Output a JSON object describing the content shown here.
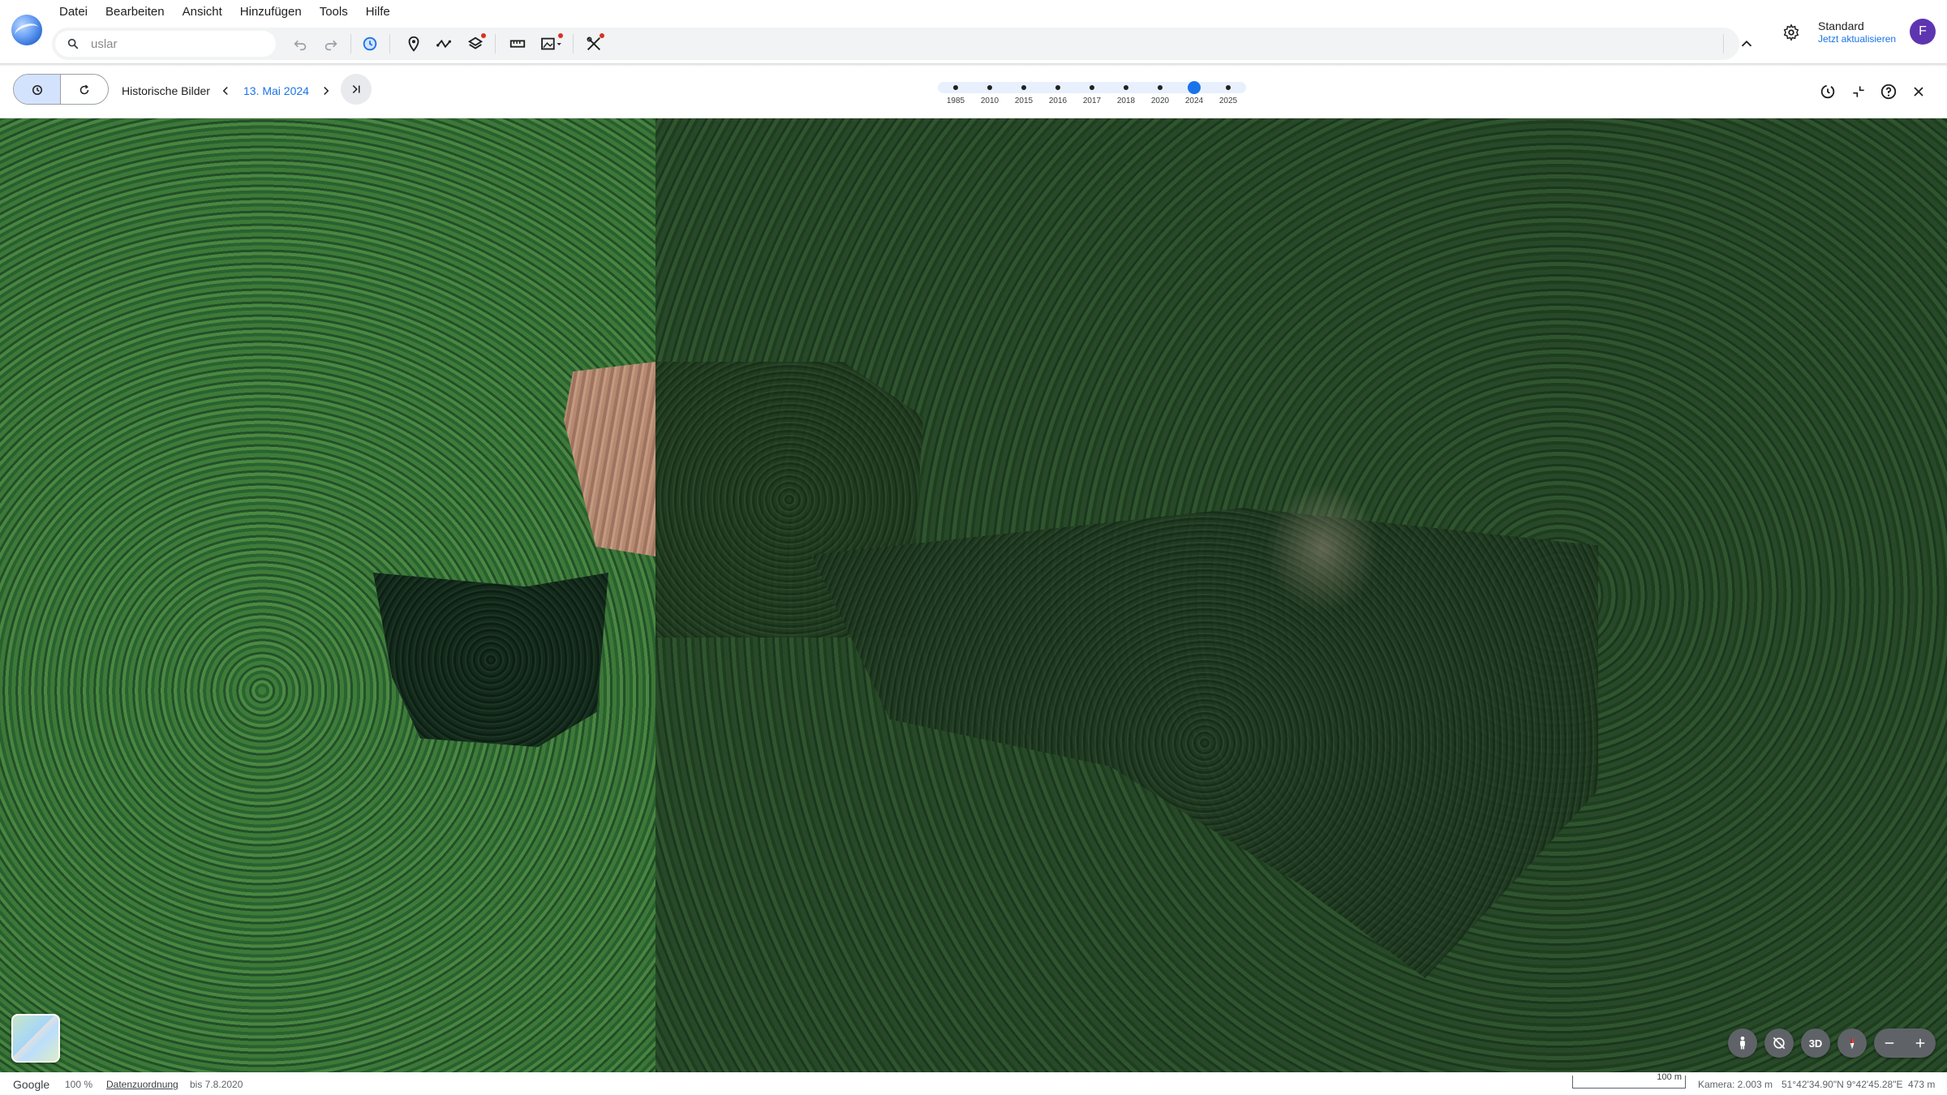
{
  "menu": {
    "items": [
      {
        "label": "Datei"
      },
      {
        "label": "Bearbeiten"
      },
      {
        "label": "Ansicht"
      },
      {
        "label": "Hinzufügen"
      },
      {
        "label": "Tools"
      },
      {
        "label": "Hilfe"
      }
    ]
  },
  "search": {
    "value": "",
    "placeholder": "uslar"
  },
  "account": {
    "plan": "Standard",
    "update": "Jetzt aktualisieren",
    "avatar_letter": "F",
    "avatar_color": "#5e35b1"
  },
  "historical": {
    "label": "Historische Bilder",
    "current_date": "13. Mai 2024",
    "years": [
      "1985",
      "2010",
      "2015",
      "2016",
      "2017",
      "2018",
      "2020",
      "2024",
      "2025"
    ],
    "selected_year": "2024"
  },
  "map_controls": {
    "three_d": "3D"
  },
  "status": {
    "brand": "Google",
    "zoom": "100 %",
    "attribution": "Datenzuordnung",
    "imagery_date": "bis 7.8.2020",
    "scale": "100 m",
    "camera": "Kamera: 2.003 m",
    "coords": "51°42'34.90\"N 9°42'45.28\"E",
    "elevation": "473 m"
  },
  "colors": {
    "accent": "#1a73e8",
    "notification_dot": "#d93025"
  }
}
